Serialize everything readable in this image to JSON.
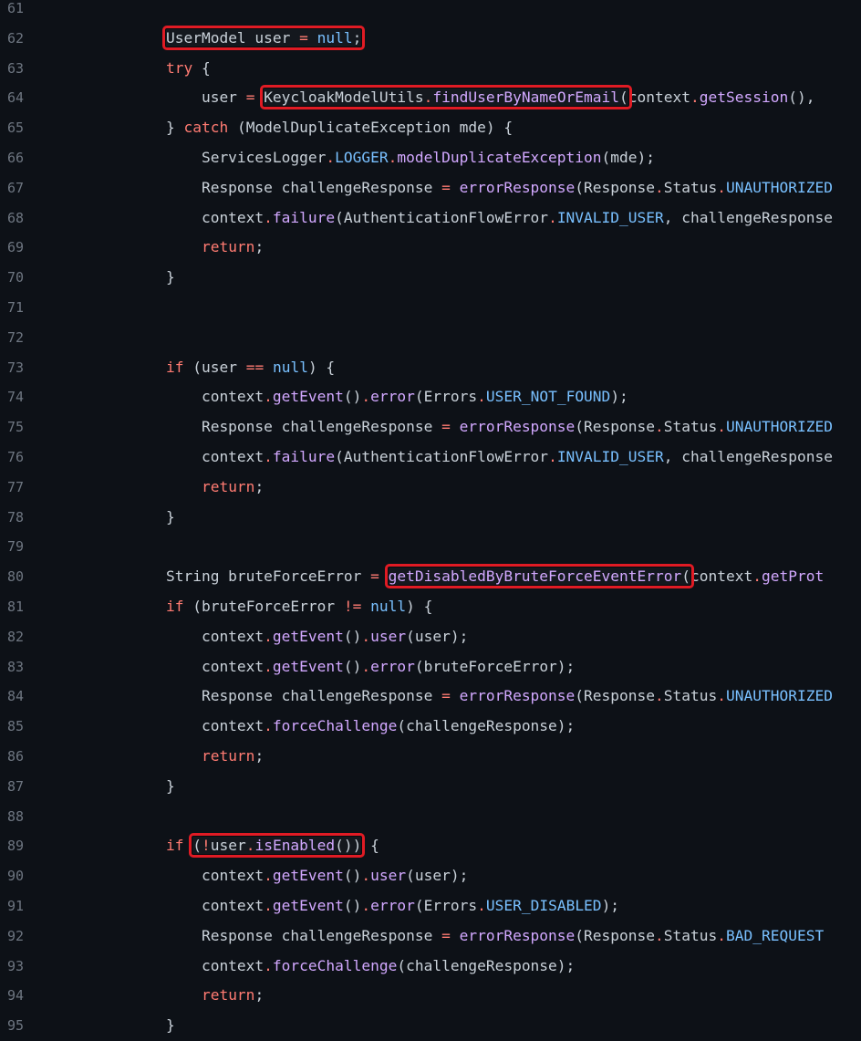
{
  "editor": {
    "lines": [
      {
        "number": "61",
        "tokens": []
      },
      {
        "number": "62",
        "tokens": [
          {
            "t": "        ",
            "c": "plain"
          },
          {
            "t": "UserModel user ",
            "c": "plain",
            "hl": "a"
          },
          {
            "t": "=",
            "c": "op",
            "hl": "a"
          },
          {
            "t": " ",
            "c": "plain",
            "hl": "a"
          },
          {
            "t": "null",
            "c": "const",
            "hl": "a"
          },
          {
            "t": ";",
            "c": "plain",
            "hl": "a"
          }
        ]
      },
      {
        "number": "63",
        "tokens": [
          {
            "t": "        ",
            "c": "plain"
          },
          {
            "t": "try",
            "c": "kw"
          },
          {
            "t": " {",
            "c": "plain"
          }
        ]
      },
      {
        "number": "64",
        "tokens": [
          {
            "t": "            user ",
            "c": "plain"
          },
          {
            "t": "=",
            "c": "op"
          },
          {
            "t": " ",
            "c": "plain"
          },
          {
            "t": "KeycloakModelUtils",
            "c": "plain",
            "hl": "b"
          },
          {
            "t": ".",
            "c": "op",
            "hl": "b"
          },
          {
            "t": "findUserByNameOrEmail",
            "c": "fn",
            "hl": "b"
          },
          {
            "t": "(",
            "c": "plain",
            "hl": "b"
          },
          {
            "t": "context",
            "c": "plain"
          },
          {
            "t": ".",
            "c": "op"
          },
          {
            "t": "getSession",
            "c": "fn"
          },
          {
            "t": "(), ",
            "c": "plain"
          }
        ]
      },
      {
        "number": "65",
        "tokens": [
          {
            "t": "        } ",
            "c": "plain"
          },
          {
            "t": "catch",
            "c": "kw"
          },
          {
            "t": " (ModelDuplicateException mde) {",
            "c": "plain"
          }
        ]
      },
      {
        "number": "66",
        "tokens": [
          {
            "t": "            ServicesLogger",
            "c": "plain"
          },
          {
            "t": ".",
            "c": "op"
          },
          {
            "t": "LOGGER",
            "c": "const"
          },
          {
            "t": ".",
            "c": "op"
          },
          {
            "t": "modelDuplicateException",
            "c": "fn"
          },
          {
            "t": "(mde);",
            "c": "plain"
          }
        ]
      },
      {
        "number": "67",
        "tokens": [
          {
            "t": "            Response challengeResponse ",
            "c": "plain"
          },
          {
            "t": "=",
            "c": "op"
          },
          {
            "t": " ",
            "c": "plain"
          },
          {
            "t": "errorResponse",
            "c": "fn"
          },
          {
            "t": "(Response",
            "c": "plain"
          },
          {
            "t": ".",
            "c": "op"
          },
          {
            "t": "Status",
            "c": "plain"
          },
          {
            "t": ".",
            "c": "op"
          },
          {
            "t": "UNAUTHORIZED",
            "c": "const"
          }
        ]
      },
      {
        "number": "68",
        "tokens": [
          {
            "t": "            context",
            "c": "plain"
          },
          {
            "t": ".",
            "c": "op"
          },
          {
            "t": "failure",
            "c": "fn"
          },
          {
            "t": "(AuthenticationFlowError",
            "c": "plain"
          },
          {
            "t": ".",
            "c": "op"
          },
          {
            "t": "INVALID_USER",
            "c": "const"
          },
          {
            "t": ", challengeResponse",
            "c": "plain"
          }
        ]
      },
      {
        "number": "69",
        "tokens": [
          {
            "t": "            ",
            "c": "plain"
          },
          {
            "t": "return",
            "c": "kw"
          },
          {
            "t": ";",
            "c": "plain"
          }
        ]
      },
      {
        "number": "70",
        "tokens": [
          {
            "t": "        }",
            "c": "plain"
          }
        ]
      },
      {
        "number": "71",
        "tokens": []
      },
      {
        "number": "72",
        "tokens": []
      },
      {
        "number": "73",
        "tokens": [
          {
            "t": "        ",
            "c": "plain"
          },
          {
            "t": "if",
            "c": "kw"
          },
          {
            "t": " (user ",
            "c": "plain"
          },
          {
            "t": "==",
            "c": "op"
          },
          {
            "t": " ",
            "c": "plain"
          },
          {
            "t": "null",
            "c": "const"
          },
          {
            "t": ") {",
            "c": "plain"
          }
        ]
      },
      {
        "number": "74",
        "tokens": [
          {
            "t": "            context",
            "c": "plain"
          },
          {
            "t": ".",
            "c": "op"
          },
          {
            "t": "getEvent",
            "c": "fn"
          },
          {
            "t": "()",
            "c": "plain"
          },
          {
            "t": ".",
            "c": "op"
          },
          {
            "t": "error",
            "c": "fn"
          },
          {
            "t": "(Errors",
            "c": "plain"
          },
          {
            "t": ".",
            "c": "op"
          },
          {
            "t": "USER_NOT_FOUND",
            "c": "const"
          },
          {
            "t": ");",
            "c": "plain"
          }
        ]
      },
      {
        "number": "75",
        "tokens": [
          {
            "t": "            Response challengeResponse ",
            "c": "plain"
          },
          {
            "t": "=",
            "c": "op"
          },
          {
            "t": " ",
            "c": "plain"
          },
          {
            "t": "errorResponse",
            "c": "fn"
          },
          {
            "t": "(Response",
            "c": "plain"
          },
          {
            "t": ".",
            "c": "op"
          },
          {
            "t": "Status",
            "c": "plain"
          },
          {
            "t": ".",
            "c": "op"
          },
          {
            "t": "UNAUTHORIZED",
            "c": "const"
          }
        ]
      },
      {
        "number": "76",
        "tokens": [
          {
            "t": "            context",
            "c": "plain"
          },
          {
            "t": ".",
            "c": "op"
          },
          {
            "t": "failure",
            "c": "fn"
          },
          {
            "t": "(AuthenticationFlowError",
            "c": "plain"
          },
          {
            "t": ".",
            "c": "op"
          },
          {
            "t": "INVALID_USER",
            "c": "const"
          },
          {
            "t": ", challengeResponse",
            "c": "plain"
          }
        ]
      },
      {
        "number": "77",
        "tokens": [
          {
            "t": "            ",
            "c": "plain"
          },
          {
            "t": "return",
            "c": "kw"
          },
          {
            "t": ";",
            "c": "plain"
          }
        ]
      },
      {
        "number": "78",
        "tokens": [
          {
            "t": "        }",
            "c": "plain"
          }
        ]
      },
      {
        "number": "79",
        "tokens": []
      },
      {
        "number": "80",
        "tokens": [
          {
            "t": "        String bruteForceError ",
            "c": "plain"
          },
          {
            "t": "=",
            "c": "op"
          },
          {
            "t": " ",
            "c": "plain"
          },
          {
            "t": "getDisabledByBruteForceEventError",
            "c": "fn",
            "hl": "c"
          },
          {
            "t": "(",
            "c": "plain",
            "hl": "c"
          },
          {
            "t": "context",
            "c": "plain"
          },
          {
            "t": ".",
            "c": "op"
          },
          {
            "t": "getProt",
            "c": "fn"
          }
        ]
      },
      {
        "number": "81",
        "tokens": [
          {
            "t": "        ",
            "c": "plain"
          },
          {
            "t": "if",
            "c": "kw"
          },
          {
            "t": " (bruteForceError ",
            "c": "plain"
          },
          {
            "t": "!=",
            "c": "op"
          },
          {
            "t": " ",
            "c": "plain"
          },
          {
            "t": "null",
            "c": "const"
          },
          {
            "t": ") {",
            "c": "plain"
          }
        ]
      },
      {
        "number": "82",
        "tokens": [
          {
            "t": "            context",
            "c": "plain"
          },
          {
            "t": ".",
            "c": "op"
          },
          {
            "t": "getEvent",
            "c": "fn"
          },
          {
            "t": "()",
            "c": "plain"
          },
          {
            "t": ".",
            "c": "op"
          },
          {
            "t": "user",
            "c": "fn"
          },
          {
            "t": "(user);",
            "c": "plain"
          }
        ]
      },
      {
        "number": "83",
        "tokens": [
          {
            "t": "            context",
            "c": "plain"
          },
          {
            "t": ".",
            "c": "op"
          },
          {
            "t": "getEvent",
            "c": "fn"
          },
          {
            "t": "()",
            "c": "plain"
          },
          {
            "t": ".",
            "c": "op"
          },
          {
            "t": "error",
            "c": "fn"
          },
          {
            "t": "(bruteForceError);",
            "c": "plain"
          }
        ]
      },
      {
        "number": "84",
        "tokens": [
          {
            "t": "            Response challengeResponse ",
            "c": "plain"
          },
          {
            "t": "=",
            "c": "op"
          },
          {
            "t": " ",
            "c": "plain"
          },
          {
            "t": "errorResponse",
            "c": "fn"
          },
          {
            "t": "(Response",
            "c": "plain"
          },
          {
            "t": ".",
            "c": "op"
          },
          {
            "t": "Status",
            "c": "plain"
          },
          {
            "t": ".",
            "c": "op"
          },
          {
            "t": "UNAUTHORIZED",
            "c": "const"
          }
        ]
      },
      {
        "number": "85",
        "tokens": [
          {
            "t": "            context",
            "c": "plain"
          },
          {
            "t": ".",
            "c": "op"
          },
          {
            "t": "forceChallenge",
            "c": "fn"
          },
          {
            "t": "(challengeResponse);",
            "c": "plain"
          }
        ]
      },
      {
        "number": "86",
        "tokens": [
          {
            "t": "            ",
            "c": "plain"
          },
          {
            "t": "return",
            "c": "kw"
          },
          {
            "t": ";",
            "c": "plain"
          }
        ]
      },
      {
        "number": "87",
        "tokens": [
          {
            "t": "        }",
            "c": "plain"
          }
        ]
      },
      {
        "number": "88",
        "tokens": []
      },
      {
        "number": "89",
        "tokens": [
          {
            "t": "        ",
            "c": "plain"
          },
          {
            "t": "if",
            "c": "kw"
          },
          {
            "t": " ",
            "c": "plain"
          },
          {
            "t": "(",
            "c": "plain",
            "hl": "d"
          },
          {
            "t": "!",
            "c": "op",
            "hl": "d"
          },
          {
            "t": "user",
            "c": "plain",
            "hl": "d"
          },
          {
            "t": ".",
            "c": "op",
            "hl": "d"
          },
          {
            "t": "isEnabled",
            "c": "fn",
            "hl": "d"
          },
          {
            "t": "())",
            "c": "plain",
            "hl": "d"
          },
          {
            "t": " {",
            "c": "plain"
          }
        ]
      },
      {
        "number": "90",
        "tokens": [
          {
            "t": "            context",
            "c": "plain"
          },
          {
            "t": ".",
            "c": "op"
          },
          {
            "t": "getEvent",
            "c": "fn"
          },
          {
            "t": "()",
            "c": "plain"
          },
          {
            "t": ".",
            "c": "op"
          },
          {
            "t": "user",
            "c": "fn"
          },
          {
            "t": "(user);",
            "c": "plain"
          }
        ]
      },
      {
        "number": "91",
        "tokens": [
          {
            "t": "            context",
            "c": "plain"
          },
          {
            "t": ".",
            "c": "op"
          },
          {
            "t": "getEvent",
            "c": "fn"
          },
          {
            "t": "()",
            "c": "plain"
          },
          {
            "t": ".",
            "c": "op"
          },
          {
            "t": "error",
            "c": "fn"
          },
          {
            "t": "(Errors",
            "c": "plain"
          },
          {
            "t": ".",
            "c": "op"
          },
          {
            "t": "USER_DISABLED",
            "c": "const"
          },
          {
            "t": ");",
            "c": "plain"
          }
        ]
      },
      {
        "number": "92",
        "tokens": [
          {
            "t": "            Response challengeResponse ",
            "c": "plain"
          },
          {
            "t": "=",
            "c": "op"
          },
          {
            "t": " ",
            "c": "plain"
          },
          {
            "t": "errorResponse",
            "c": "fn"
          },
          {
            "t": "(Response",
            "c": "plain"
          },
          {
            "t": ".",
            "c": "op"
          },
          {
            "t": "Status",
            "c": "plain"
          },
          {
            "t": ".",
            "c": "op"
          },
          {
            "t": "BAD_REQUEST",
            "c": "const"
          }
        ]
      },
      {
        "number": "93",
        "tokens": [
          {
            "t": "            context",
            "c": "plain"
          },
          {
            "t": ".",
            "c": "op"
          },
          {
            "t": "forceChallenge",
            "c": "fn"
          },
          {
            "t": "(challengeResponse);",
            "c": "plain"
          }
        ]
      },
      {
        "number": "94",
        "tokens": [
          {
            "t": "            ",
            "c": "plain"
          },
          {
            "t": "return",
            "c": "kw"
          },
          {
            "t": ";",
            "c": "plain"
          }
        ]
      },
      {
        "number": "95",
        "tokens": [
          {
            "t": "        }",
            "c": "plain"
          }
        ]
      }
    ]
  },
  "colors": {
    "background": "#0d1117",
    "text": "#c9d1d9",
    "line_number": "#6e7681",
    "keyword": "#ff7b72",
    "function": "#d2a8ff",
    "constant": "#79c0ff",
    "highlight_box": "#e01b24"
  }
}
